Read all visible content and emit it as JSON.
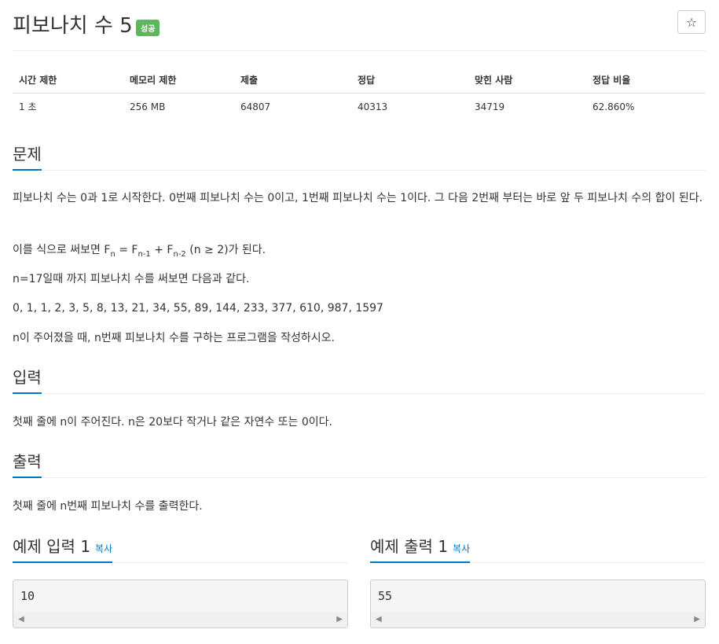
{
  "header": {
    "title": "피보나치 수 5",
    "badge": "성공",
    "star_icon": "☆"
  },
  "stats": {
    "columns": [
      "시간 제한",
      "메모리 제한",
      "제출",
      "정답",
      "맞힌 사람",
      "정답 비율"
    ],
    "row": [
      "1 초",
      "256 MB",
      "64807",
      "40313",
      "34719",
      "62.860%"
    ]
  },
  "problem": {
    "heading": "문제",
    "p1": "피보나치 수는 0과 1로 시작한다. 0번째 피보나치 수는 0이고, 1번째 피보나치 수는 1이다. 그 다음 2번째 부터는 바로 앞 두 피보나치 수의 합이 된다.",
    "formula_prefix": "이를 식으로 써보면 F",
    "formula_sub1": "n",
    "formula_mid1": " = F",
    "formula_sub2": "n-1",
    "formula_mid2": " + F",
    "formula_sub3": "n-2",
    "formula_suffix": " (n ≥ 2)가 된다.",
    "p3": "n=17일때 까지 피보나치 수를 써보면 다음과 같다.",
    "p4": "0, 1, 1, 2, 3, 5, 8, 13, 21, 34, 55, 89, 144, 233, 377, 610, 987, 1597",
    "p5": "n이 주어졌을 때, n번째 피보나치 수를 구하는 프로그램을 작성하시오."
  },
  "input": {
    "heading": "입력",
    "text": "첫째 줄에 n이 주어진다. n은 20보다 작거나 같은 자연수 또는 0이다."
  },
  "output": {
    "heading": "출력",
    "text": "첫째 줄에 n번째 피보나치 수를 출력한다."
  },
  "examples": {
    "input_heading": "예제 입력 1",
    "output_heading": "예제 출력 1",
    "copy_label": "복사",
    "input_value": "10",
    "output_value": "55",
    "scroll_left": "◀",
    "scroll_right": "▶"
  }
}
